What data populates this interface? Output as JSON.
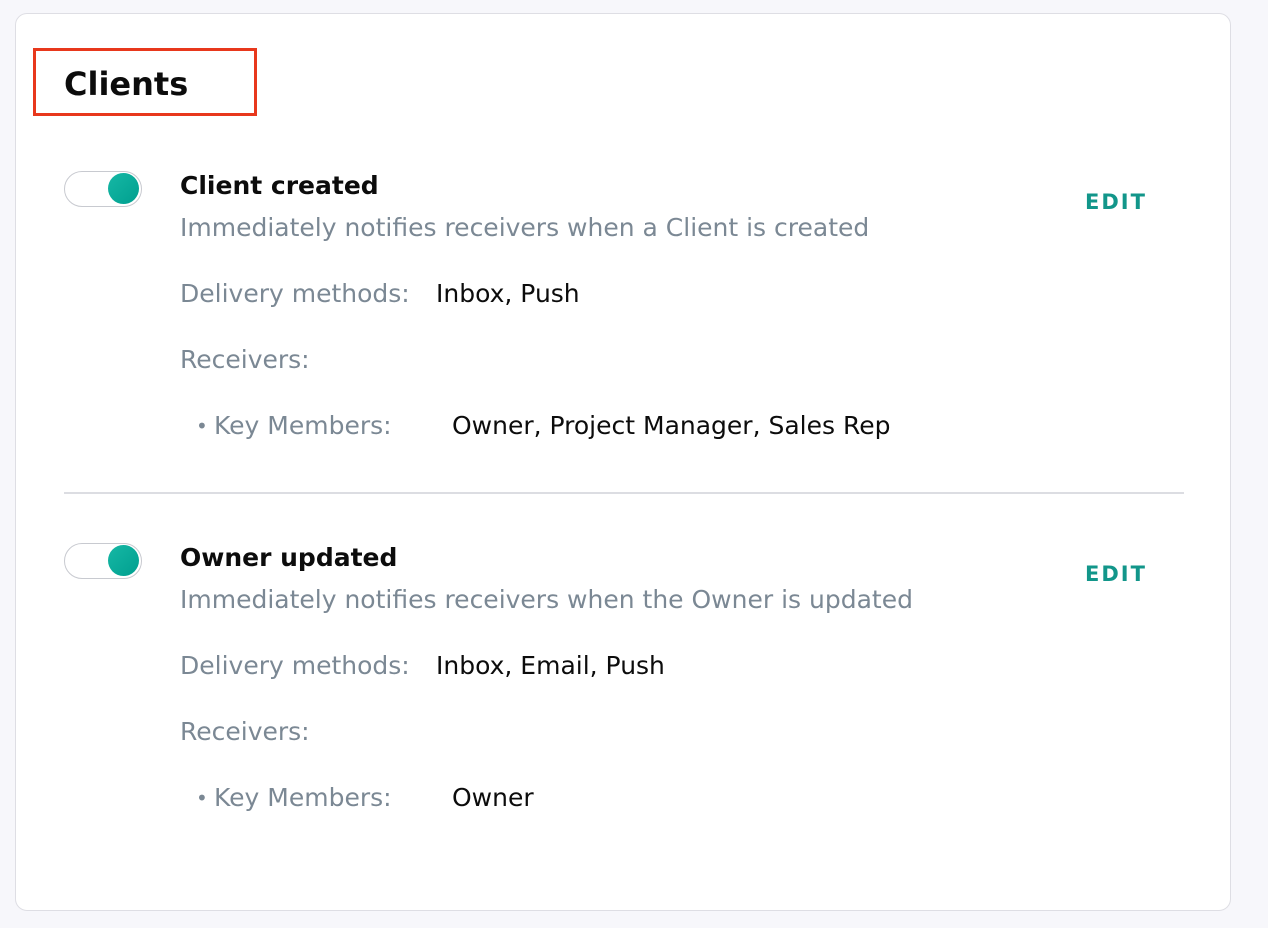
{
  "section": {
    "title": "Clients"
  },
  "rules": [
    {
      "name": "Client created",
      "description": "Immediately notifies receivers when a Client is created",
      "enabled": true,
      "edit_label": "EDIT",
      "delivery_label": "Delivery methods:",
      "delivery_value": "Inbox, Push",
      "receivers_label": "Receivers:",
      "bullet": "•",
      "key_members_label": "Key Members:",
      "key_members_value": "Owner, Project Manager, Sales Rep"
    },
    {
      "name": "Owner updated",
      "description": "Immediately notifies receivers when the Owner is updated",
      "enabled": true,
      "edit_label": "EDIT",
      "delivery_label": "Delivery methods:",
      "delivery_value": "Inbox, Email, Push",
      "receivers_label": "Receivers:",
      "bullet": "•",
      "key_members_label": "Key Members:",
      "key_members_value": "Owner"
    }
  ],
  "colors": {
    "accent": "#12968a",
    "toggle_on": "#00a896",
    "highlight_border": "#e8381c",
    "muted_text": "#7b8894"
  },
  "icons": {
    "toggle": "toggle-switch-on"
  }
}
